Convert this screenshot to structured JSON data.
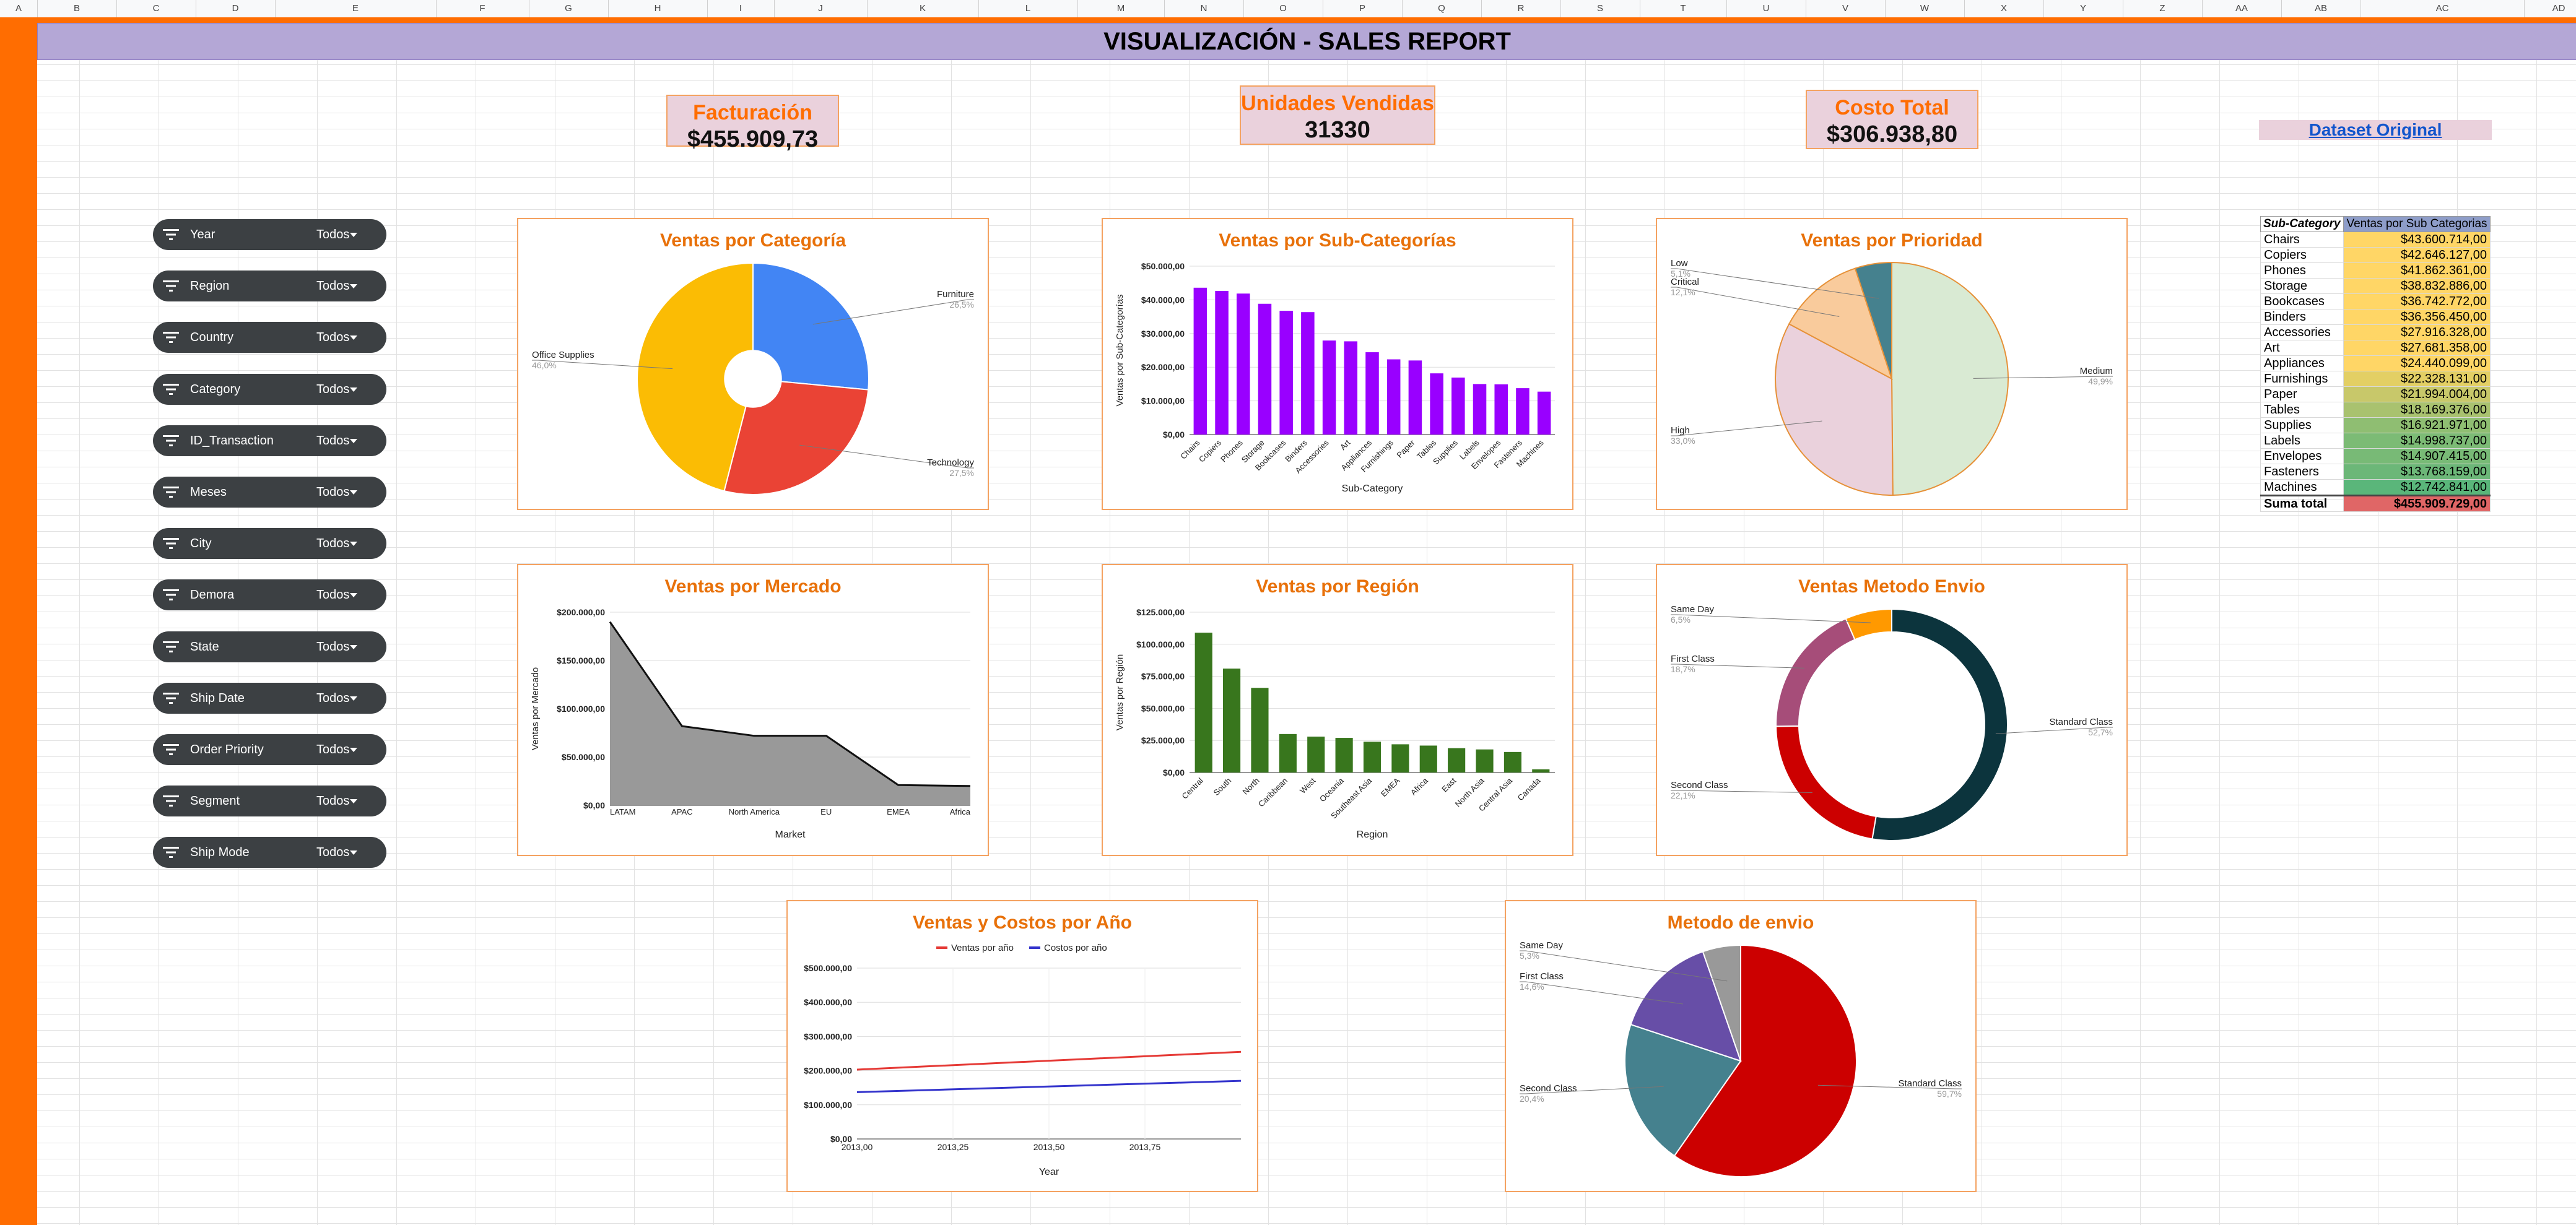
{
  "column_headers": [
    "A",
    "B",
    "C",
    "D",
    "E",
    "F",
    "G",
    "H",
    "I",
    "J",
    "K",
    "L",
    "M",
    "N",
    "O",
    "P",
    "Q",
    "R",
    "S",
    "T",
    "U",
    "V",
    "W",
    "X",
    "Y",
    "Z",
    "AA",
    "AB",
    "AC",
    "AD"
  ],
  "title": "VISUALIZACIÓN - SALES REPORT",
  "kpis": {
    "facturacion": {
      "label": "Facturación",
      "value": "$455.909,73"
    },
    "unidades": {
      "label": "Unidades Vendidas",
      "value": "31330"
    },
    "costo": {
      "label": "Costo Total",
      "value": "$306.938,80"
    }
  },
  "dataset_link": "Dataset Original",
  "filters": [
    {
      "label": "Year",
      "value": "Todos"
    },
    {
      "label": "Region",
      "value": "Todos"
    },
    {
      "label": "Country",
      "value": "Todos"
    },
    {
      "label": "Category",
      "value": "Todos"
    },
    {
      "label": "ID_Transaction",
      "value": "Todos"
    },
    {
      "label": "Meses",
      "value": "Todos"
    },
    {
      "label": "City",
      "value": "Todos"
    },
    {
      "label": "Demora",
      "value": "Todos"
    },
    {
      "label": "State",
      "value": "Todos"
    },
    {
      "label": "Ship Date",
      "value": "Todos"
    },
    {
      "label": "Order Priority",
      "value": "Todos"
    },
    {
      "label": "Segment",
      "value": "Todos"
    },
    {
      "label": "Ship Mode",
      "value": "Todos"
    }
  ],
  "pivot": {
    "headers": [
      "Sub-Category",
      "Ventas por Sub Categorias"
    ],
    "rows": [
      [
        "Chairs",
        "$43.600.714,00"
      ],
      [
        "Copiers",
        "$42.646.127,00"
      ],
      [
        "Phones",
        "$41.862.361,00"
      ],
      [
        "Storage",
        "$38.832.886,00"
      ],
      [
        "Bookcases",
        "$36.742.772,00"
      ],
      [
        "Binders",
        "$36.356.450,00"
      ],
      [
        "Accessories",
        "$27.916.328,00"
      ],
      [
        "Art",
        "$27.681.358,00"
      ],
      [
        "Appliances",
        "$24.440.099,00"
      ],
      [
        "Furnishings",
        "$22.328.131,00"
      ],
      [
        "Paper",
        "$21.994.004,00"
      ],
      [
        "Tables",
        "$18.169.376,00"
      ],
      [
        "Supplies",
        "$16.921.971,00"
      ],
      [
        "Labels",
        "$14.998.737,00"
      ],
      [
        "Envelopes",
        "$14.907.415,00"
      ],
      [
        "Fasteners",
        "$13.768.159,00"
      ],
      [
        "Machines",
        "$12.742.841,00"
      ]
    ],
    "total_label": "Suma total",
    "total_value": "$455.909.729,00"
  },
  "chart_data": [
    {
      "id": "cat",
      "type": "pie",
      "title": "Ventas por Categoría",
      "donut_hole": true,
      "slices": [
        {
          "label": "Furniture",
          "pct": "26,5%",
          "value": 26.5,
          "color": "#4285f4"
        },
        {
          "label": "Technology",
          "pct": "27,5%",
          "value": 27.5,
          "color": "#ea4335"
        },
        {
          "label": "Office Supplies",
          "pct": "46,0%",
          "value": 46.0,
          "color": "#fbbc04"
        }
      ]
    },
    {
      "id": "subcat",
      "type": "bar",
      "title": "Ventas por Sub-Categorías",
      "xlabel": "Sub-Category",
      "ylabel": "Ventas por Sub-Categorías",
      "ylim": [
        0,
        50000000
      ],
      "yticks": [
        "$0,00",
        "$10.000,00",
        "$20.000,00",
        "$30.000,00",
        "$40.000,00",
        "$50.000,00"
      ],
      "color": "#9900ff",
      "categories": [
        "Chairs",
        "Copiers",
        "Phones",
        "Storage",
        "Bookcases",
        "Binders",
        "Accessories",
        "Art",
        "Appliances",
        "Furnishings",
        "Paper",
        "Tables",
        "Supplies",
        "Labels",
        "Envelopes",
        "Fasteners",
        "Machines"
      ],
      "values": [
        43600714,
        42646127,
        41862361,
        38832886,
        36742772,
        36356450,
        27916328,
        27681358,
        24440099,
        22328131,
        21994004,
        18169376,
        16921971,
        14998737,
        14907415,
        13768159,
        12742841
      ]
    },
    {
      "id": "prio",
      "type": "pie",
      "title": "Ventas por Prioridad",
      "slices": [
        {
          "label": "Medium",
          "pct": "49,9%",
          "value": 49.9,
          "color": "#d9ead3"
        },
        {
          "label": "High",
          "pct": "33,0%",
          "value": 33.0,
          "color": "#ead1dc"
        },
        {
          "label": "Critical",
          "pct": "12,1%",
          "value": 12.1,
          "color": "#f9cb9c"
        },
        {
          "label": "Low",
          "pct": "5,1%",
          "value": 5.1,
          "color": "#45818e"
        }
      ]
    },
    {
      "id": "mercado",
      "type": "area",
      "title": "Ventas por Mercado",
      "xlabel": "Market",
      "ylabel": "Ventas por Mercado",
      "ylim": [
        0,
        200000
      ],
      "yticks": [
        "$0,00",
        "$50.000,00",
        "$100.000,00",
        "$150.000,00",
        "$200.000,00"
      ],
      "color": "#999999",
      "categories": [
        "LATAM",
        "APAC",
        "North America",
        "EU",
        "EMEA",
        "Africa"
      ],
      "values": [
        190000,
        82000,
        72000,
        72000,
        21000,
        20000
      ]
    },
    {
      "id": "region",
      "type": "bar",
      "title": "Ventas por Región",
      "xlabel": "Region",
      "ylabel": "Ventas por Región",
      "ylim": [
        0,
        125000
      ],
      "yticks": [
        "$0,00",
        "$25.000,00",
        "$50.000,00",
        "$75.000,00",
        "$100.000,00",
        "$125.000,00"
      ],
      "color": "#38761d",
      "categories": [
        "Central",
        "South",
        "North",
        "Caribbean",
        "West",
        "Oceania",
        "Southeast Asia",
        "EMEA",
        "Africa",
        "East",
        "North Asia",
        "Central Asia",
        "Canada"
      ],
      "values": [
        109000,
        81000,
        66000,
        30000,
        28000,
        27000,
        24000,
        22000,
        21000,
        19000,
        18000,
        16000,
        2500
      ]
    },
    {
      "id": "envio",
      "type": "pie",
      "title": "Ventas Metodo Envio",
      "donut": true,
      "slices": [
        {
          "label": "Standard Class",
          "pct": "52,7%",
          "value": 52.7,
          "color": "#0c343d"
        },
        {
          "label": "Second Class",
          "pct": "22,1%",
          "value": 22.1,
          "color": "#cc0000"
        },
        {
          "label": "First Class",
          "pct": "18,7%",
          "value": 18.7,
          "color": "#a64d79"
        },
        {
          "label": "Same Day",
          "pct": "6,5%",
          "value": 6.5,
          "color": "#ff9900"
        }
      ]
    },
    {
      "id": "anio",
      "type": "line",
      "title": "Ventas y Costos por Año",
      "xlabel": "Year",
      "ylim": [
        0,
        500000
      ],
      "yticks": [
        "$0,00",
        "$100.000,00",
        "$200.000,00",
        "$300.000,00",
        "$400.000,00",
        "$500.000,00"
      ],
      "xticks": [
        "2013,00",
        "2013,25",
        "2013,50",
        "2013,75"
      ],
      "series": [
        {
          "name": "Ventas por año",
          "color": "#e53935",
          "values": [
            203000,
            255000
          ]
        },
        {
          "name": "Costos por año",
          "color": "#3333cc",
          "values": [
            137000,
            170000
          ]
        }
      ]
    },
    {
      "id": "metodo",
      "type": "pie",
      "title": "Metodo de envio",
      "slices": [
        {
          "label": "Standard Class",
          "pct": "59,7%",
          "value": 59.7,
          "color": "#cc0000"
        },
        {
          "label": "Second Class",
          "pct": "20,4%",
          "value": 20.4,
          "color": "#45818e"
        },
        {
          "label": "First Class",
          "pct": "14,6%",
          "value": 14.6,
          "color": "#674ea7"
        },
        {
          "label": "Same Day",
          "pct": "5,3%",
          "value": 5.3,
          "color": "#999999"
        }
      ]
    }
  ]
}
